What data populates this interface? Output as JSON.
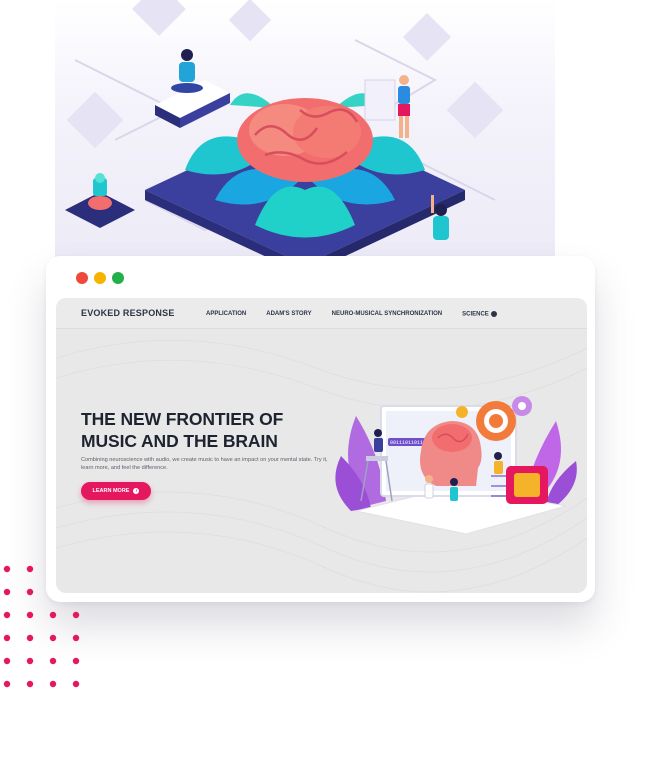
{
  "browser_controls": {
    "close_color": "#ee4a3c",
    "minimize_color": "#f6b300",
    "maximize_color": "#23b04a"
  },
  "site": {
    "brand": "EVOKED RESPONSE",
    "nav": [
      "APPLICATION",
      "ADAM'S STORY",
      "NEURO-MUSICAL SYNCHRONIZATION",
      "SCIENCE"
    ],
    "nav_icon": "circle-arrow-icon",
    "headline_line1": "THE NEW FRONTIER OF",
    "headline_line2": "MUSIC AND THE BRAIN",
    "subtext": "Combining neuroscience with audio, we create music to have an impact on your mental state. Try it, learn more, and feel the difference.",
    "cta_label": "LEARN MORE",
    "cta_icon": "circle-arrow-icon",
    "screen_code": "00111011011111",
    "accent_color": "#e5175e"
  },
  "illustrations": {
    "top": "isometric-brain-lotus-illustration",
    "hero": "brain-science-illustration",
    "decoration": "pink-dot-grid"
  }
}
